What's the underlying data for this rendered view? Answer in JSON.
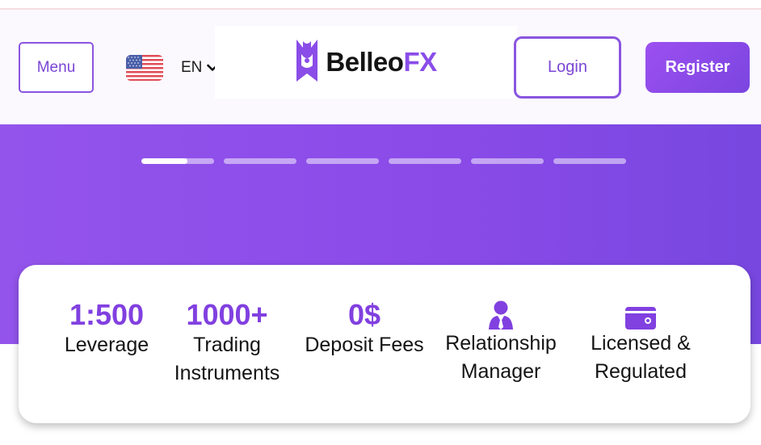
{
  "header": {
    "menu_label": "Menu",
    "language": "EN",
    "flag_icon": "us-flag-icon",
    "logo_text_main": "Belleo",
    "logo_text_accent": "FX",
    "login_label": "Login",
    "register_label": "Register"
  },
  "colors": {
    "brand_purple": "#8a4de8",
    "hero_start": "#9354ec",
    "hero_end": "#7747e0",
    "text_dark": "#141414"
  },
  "slider": {
    "slide_count": 6,
    "active_index": 0,
    "active_progress": 0.63
  },
  "features": [
    {
      "value": "1:500",
      "label_1": "Leverage",
      "label_2": ""
    },
    {
      "value": "1000+",
      "label_1": "Trading",
      "label_2": "Instruments"
    },
    {
      "value": "0$",
      "label_1": "Deposit Fees",
      "label_2": ""
    },
    {
      "icon": "relationship-manager-icon",
      "label_1": "Relationship",
      "label_2": "Manager"
    },
    {
      "icon": "license-card-icon",
      "label_1": "Licensed &",
      "label_2": "Regulated"
    }
  ]
}
